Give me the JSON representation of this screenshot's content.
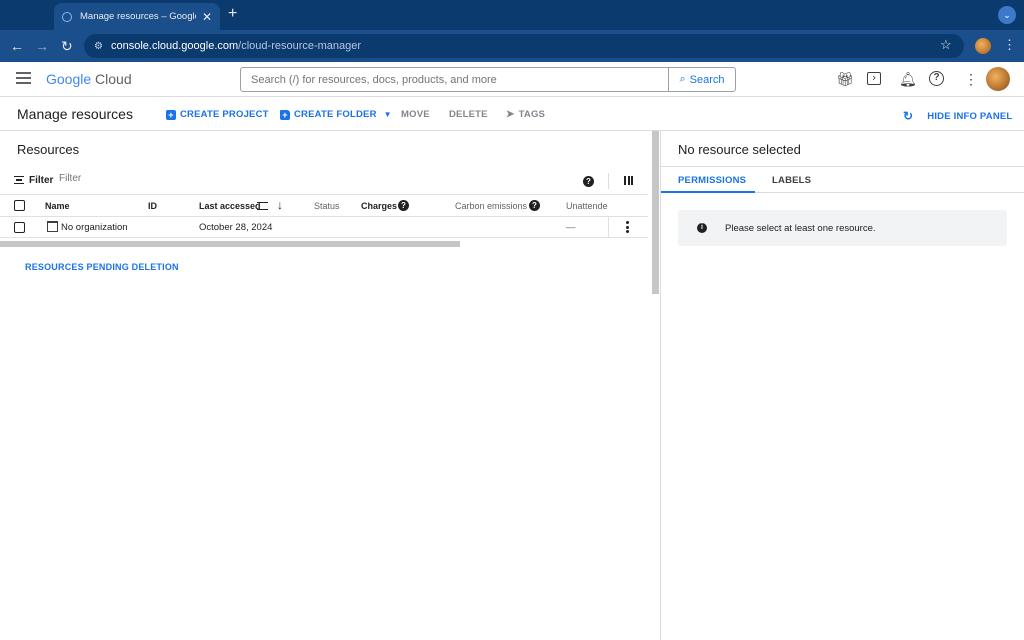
{
  "browser": {
    "tab_title": "Manage resources – Google Cloud",
    "url_host": "console.cloud.google.com",
    "url_path": "/cloud-resource-manager"
  },
  "header": {
    "logo_google": "Google",
    "logo_cloud": "Cloud",
    "search_placeholder": "Search (/) for resources, docs, products, and more",
    "search_button": "Search"
  },
  "actionbar": {
    "page_title": "Manage resources",
    "create_project": "CREATE PROJECT",
    "create_folder": "CREATE FOLDER",
    "move": "MOVE",
    "delete": "DELETE",
    "tags": "TAGS",
    "hide_info_panel": "HIDE INFO PANEL"
  },
  "resources": {
    "title": "Resources",
    "filter_label": "Filter",
    "filter_placeholder": "Filter",
    "columns": [
      "Name",
      "ID",
      "Last accessed",
      "Status",
      "Charges",
      "Carbon emissions",
      "Unattended"
    ],
    "rows": [
      {
        "name": "No organization",
        "id": "",
        "last_accessed": "October 28, 2024",
        "status": "",
        "charges": "",
        "carbon": "",
        "unattended": "—"
      }
    ],
    "pending_deletion": "RESOURCES PENDING DELETION"
  },
  "info_panel": {
    "title": "No resource selected",
    "tabs": [
      "PERMISSIONS",
      "LABELS"
    ],
    "message": "Please select at least one resource."
  }
}
